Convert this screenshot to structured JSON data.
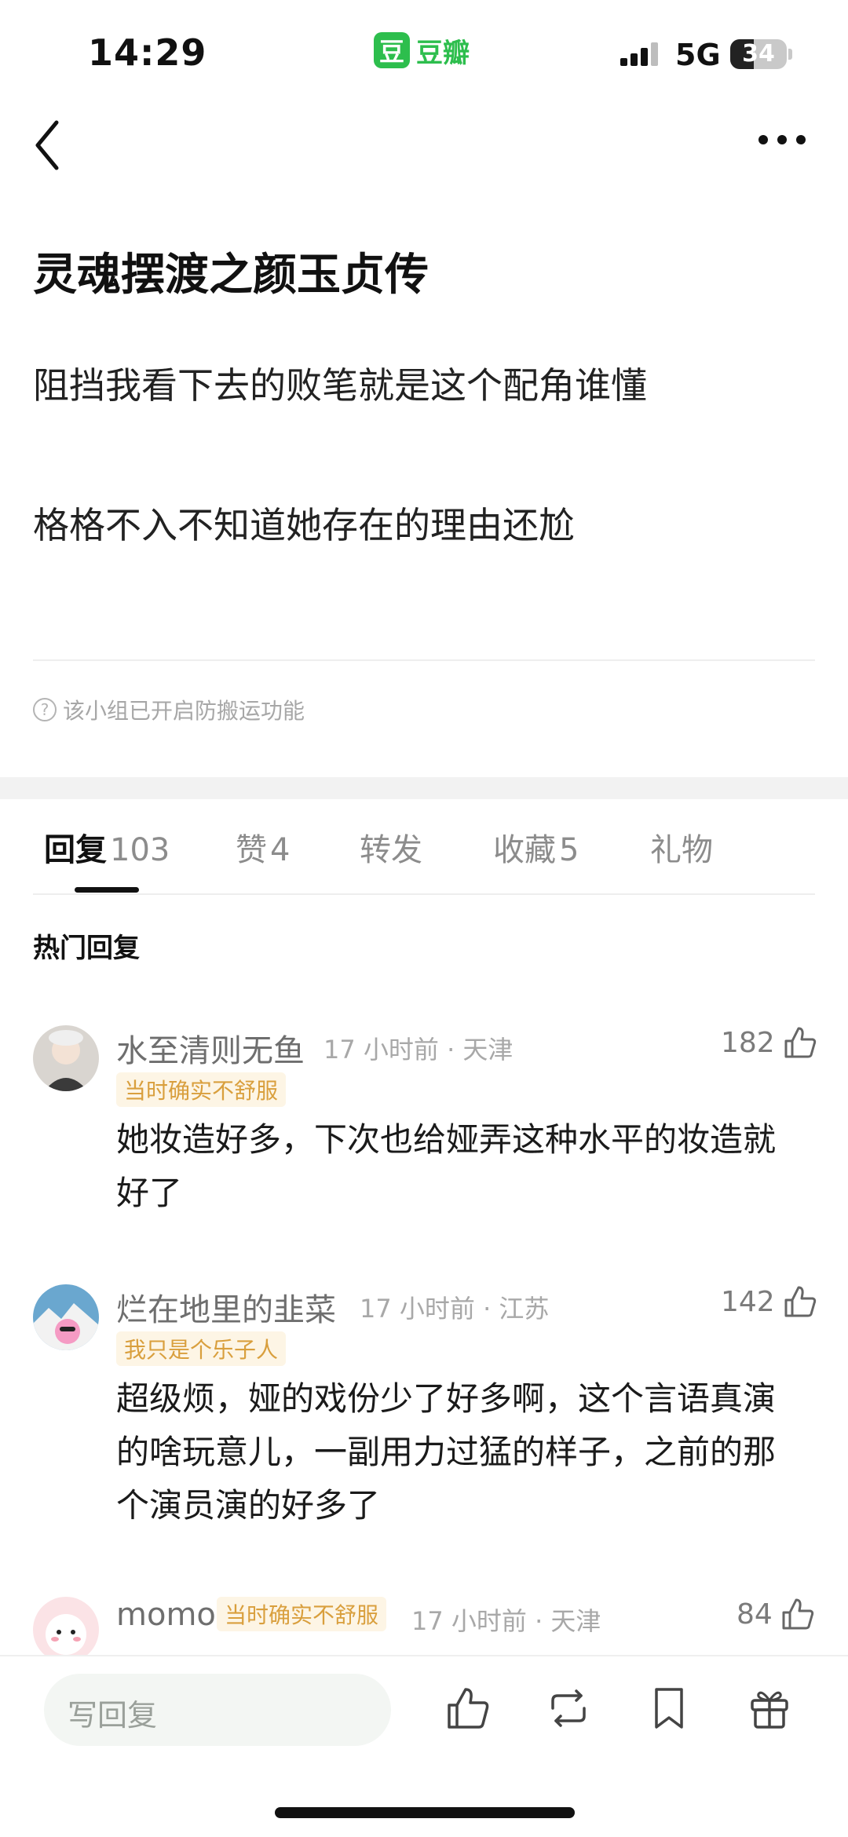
{
  "status": {
    "time": "14:29",
    "network": "5G",
    "battery": "34"
  },
  "app": {
    "logo_char": "豆",
    "name": "豆瓣"
  },
  "post": {
    "title": "灵魂摆渡之颜玉贞传",
    "paragraphs": [
      "阻挡我看下去的败笔就是这个配角谁懂",
      "格格不入不知道她存在的理由还尬"
    ],
    "anti_repost_notice": "该小组已开启防搬运功能"
  },
  "tabs": [
    {
      "label": "回复",
      "count": "103"
    },
    {
      "label": "赞",
      "count": "4"
    },
    {
      "label": "转发",
      "count": ""
    },
    {
      "label": "收藏",
      "count": "5"
    },
    {
      "label": "礼物",
      "count": ""
    }
  ],
  "section_title": "热门回复",
  "comments": [
    {
      "user": "水至清则无鱼",
      "meta": "17 小时前 · 天津",
      "badge": "当时确实不舒服",
      "likes": "182",
      "text": "她妆造好多，下次也给娅弄这种水平的妆造就好了"
    },
    {
      "user": "烂在地里的韭菜",
      "meta": "17 小时前 · 江苏",
      "badge": "我只是个乐子人",
      "likes": "142",
      "text": "超级烦，娅的戏份少了好多啊，这个言语真演的啥玩意儿，一副用力过猛的样子，之前的那个演员演的好多了"
    },
    {
      "user": "momo",
      "meta": "17 小时前 · 天津",
      "badge": "当时确实不舒服",
      "likes": "84",
      "text": ""
    }
  ],
  "bottom": {
    "reply_placeholder": "写回复"
  },
  "colors": {
    "brand": "#2dbe4d",
    "badge_text": "#d99f3d",
    "badge_bg": "#fdf5e5"
  }
}
